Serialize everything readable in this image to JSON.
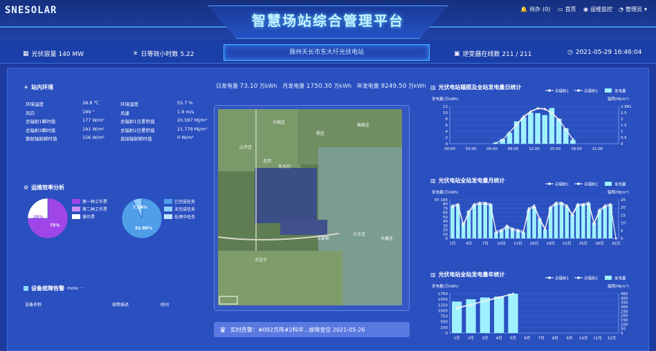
{
  "header": {
    "logo": "SNESOLAR",
    "title": "智慧场站综合管理平台",
    "nav": [
      {
        "label": "待办",
        "count": "(0)"
      },
      {
        "label": "首页"
      },
      {
        "label": "运维监控"
      },
      {
        "label": "管理员"
      }
    ]
  },
  "status": {
    "capacity": "光伏容量 140 MW",
    "hours": "日等效小时数 5.22",
    "station": "滁州天长市东大圩光伏电站",
    "inverters": "逆变器在线数 211 / 211",
    "datetime": "2021-05-29 16:46:04"
  },
  "env": {
    "title": "站内环境",
    "left": [
      {
        "label": "环境温度",
        "value": "28.8 ℃"
      },
      {
        "label": "风向",
        "value": "199 °"
      },
      {
        "label": "总辐射1瞬时值",
        "value": "177 W/m²"
      },
      {
        "label": "总辐射2瞬时值",
        "value": "191 W/m²"
      },
      {
        "label": "散射辐射瞬时值",
        "value": "156 W/m²"
      }
    ],
    "right": [
      {
        "label": "环境湿度",
        "value": "55.7 %"
      },
      {
        "label": "风速",
        "value": "1.9 m/s"
      },
      {
        "label": "总辐射1日累积值",
        "value": "20.597 MJ/m²"
      },
      {
        "label": "总辐射2日累积值",
        "value": "21.779 MJ/m²"
      },
      {
        "label": "直接辐射瞬时值",
        "value": "0 W/m²"
      }
    ]
  },
  "efficiency": {
    "title": "运维效率分析",
    "pie1": {
      "label_main": "75%",
      "label_minor": "25%",
      "legend": [
        "第一种工作票",
        "第二种工作票",
        "操作票"
      ],
      "colors": [
        "#a046e8",
        "#cf8ff5",
        "#ffffff"
      ],
      "values": [
        75,
        0,
        25
      ]
    },
    "pie2": {
      "label_main": "92.86%",
      "label_minor": "7.14%",
      "legend": [
        "已完成任务",
        "未完成任务",
        "处理中任务"
      ],
      "colors": [
        "#4e9ee8",
        "#8fd0ff",
        "#bfe6ff"
      ],
      "values": [
        92.86,
        7.14,
        0
      ]
    }
  },
  "faults": {
    "title": "设备故障告警",
    "more": "more ···",
    "columns": [
      "设备名称",
      "故障描述",
      "时间"
    ]
  },
  "generation": {
    "day_label": "日发电量",
    "day_value": "73.10",
    "day_unit": "万kWh",
    "month_label": "月发电量",
    "month_value": "1750.30",
    "month_unit": "万kWh",
    "year_label": "年发电量",
    "year_value": "9249.50",
    "year_unit": "万kWh"
  },
  "map": {
    "labels": [
      "大姚庄",
      "山子庄",
      "杨庄",
      "高家庄",
      "北邓",
      "东大圩",
      "王家甸",
      "大王庄",
      "大秦庄",
      "王庄子"
    ]
  },
  "alarm": {
    "text": "实时告警：#092方阵#2科华...故障变位 2021-05-26"
  },
  "colors": {
    "bar": "#9ff1ff",
    "line1": "#ffffff",
    "line2": "#e8e8e8",
    "axis": "#9fc3ff"
  },
  "chart_data": [
    {
      "type": "bar",
      "title": "光伏电站辐照及全站发电量日统计",
      "legend": [
        "总辐射1",
        "总辐射2",
        "发电量"
      ],
      "ylabel": "发电量(万kWh)",
      "y2label": "辐照(MJ/m²)",
      "xticks": [
        "00:00",
        "03:00",
        "06:00",
        "09:00",
        "12:00",
        "15:00",
        "18:00",
        "21:00"
      ],
      "yticks": [
        "0",
        "2",
        "4",
        "6",
        "8",
        "10",
        "12"
      ],
      "y2ticks": [
        "0",
        "0.5",
        "1",
        "1.5",
        "2",
        "2.5",
        "2.981"
      ],
      "ylim": [
        0,
        12
      ],
      "y2lim": [
        0,
        2.981
      ],
      "x": [
        6,
        7,
        8,
        9,
        10,
        11,
        12,
        13,
        14,
        15,
        16,
        17
      ],
      "bar_values": [
        0.3,
        1.5,
        3.5,
        7.2,
        8.5,
        10.0,
        9.8,
        9.2,
        11.5,
        8.0,
        5.0,
        1.2
      ],
      "line1": [
        0.05,
        0.3,
        0.9,
        1.5,
        2.1,
        2.55,
        2.8,
        2.75,
        2.45,
        1.9,
        1.1,
        0.35
      ],
      "line2": [
        0.05,
        0.32,
        0.92,
        1.55,
        2.2,
        2.6,
        2.85,
        2.8,
        2.5,
        1.95,
        1.15,
        0.38
      ]
    },
    {
      "type": "bar",
      "title": "光伏电站全站发电量月统计",
      "legend": [
        "总辐射1",
        "总辐射2",
        "发电量"
      ],
      "ylabel": "发电量(万kWh)",
      "y2label": "辐照(MJ/m²)",
      "xticks": [
        "1日",
        "4日",
        "7日",
        "10日",
        "13日",
        "16日",
        "19日",
        "22日",
        "25日",
        "28日",
        "31日"
      ],
      "yticks": [
        "0",
        "10",
        "20",
        "30",
        "40",
        "50",
        "60",
        "70",
        "80",
        "97.195"
      ],
      "y2ticks": [
        "0",
        "5",
        "10",
        "15",
        "20",
        "25"
      ],
      "ylim": [
        0,
        97.195
      ],
      "y2lim": [
        0,
        27
      ],
      "bar_values": [
        82,
        85,
        40,
        70,
        85,
        88,
        90,
        85,
        15,
        20,
        30,
        25,
        20,
        15,
        72,
        80,
        50,
        22,
        78,
        88,
        90,
        80,
        60,
        85,
        86,
        88,
        40,
        72,
        80,
        85,
        0
      ],
      "line1": [
        22,
        23,
        9,
        18,
        23,
        24,
        24,
        23,
        4,
        5,
        8,
        6,
        5,
        4,
        20,
        22,
        13,
        6,
        21,
        24,
        24,
        22,
        16,
        23,
        23,
        24,
        10,
        19,
        22,
        23,
        0
      ],
      "line2": [
        23,
        24,
        10,
        19,
        24,
        25,
        25,
        24,
        5,
        6,
        9,
        7,
        6,
        5,
        21,
        23,
        14,
        7,
        22,
        25,
        25,
        23,
        17,
        24,
        24,
        25,
        11,
        20,
        23,
        24,
        0
      ]
    },
    {
      "type": "bar",
      "title": "光伏电站全站发电量年统计",
      "legend": [
        "总辐射1",
        "总辐射2",
        "发电量"
      ],
      "ylabel": "发电量(万kWh)",
      "y2label": "辐照(MJ/m²)",
      "xticks": [
        "1月",
        "2月",
        "3月",
        "4月",
        "5月",
        "6月",
        "7月",
        "8月",
        "9月",
        "10月",
        "11月",
        "12月"
      ],
      "yticks": [
        "0",
        "250",
        "500",
        "750",
        "1000",
        "1250",
        "1500",
        "1750"
      ],
      "y2ticks": [
        "0",
        "50",
        "100",
        "150",
        "200",
        "250",
        "300",
        "350",
        "400",
        "482"
      ],
      "ylim": [
        0,
        1750
      ],
      "y2lim": [
        0,
        482
      ],
      "bar_values": [
        1400,
        1500,
        1580,
        1620,
        1750,
        0,
        0,
        0,
        0,
        0,
        0,
        0
      ],
      "line1": [
        300,
        345,
        390,
        430,
        480,
        null,
        null,
        null,
        null,
        null,
        null,
        null
      ],
      "line2": [
        310,
        350,
        395,
        440,
        482,
        null,
        null,
        null,
        null,
        null,
        null,
        null
      ]
    }
  ]
}
